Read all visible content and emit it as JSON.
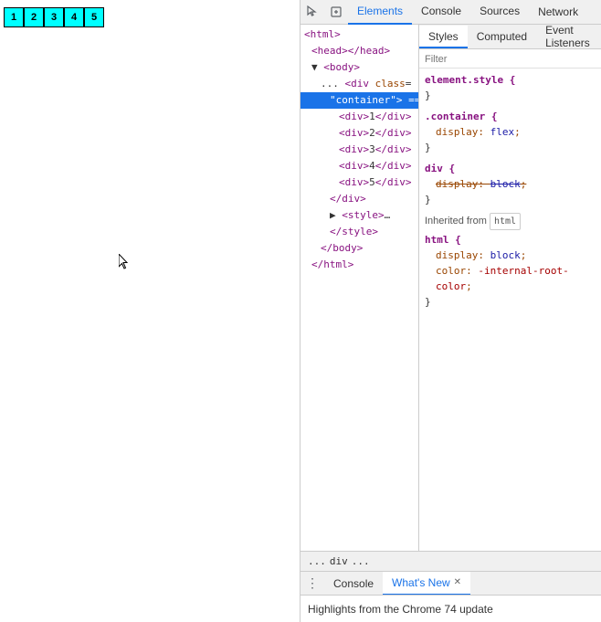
{
  "preview": {
    "boxes": [
      {
        "label": "1"
      },
      {
        "label": "2"
      },
      {
        "label": "3"
      },
      {
        "label": "4"
      },
      {
        "label": "5"
      }
    ]
  },
  "devtools": {
    "toolbar": {
      "tabs": [
        "Elements",
        "Console",
        "Sources",
        "Network"
      ]
    },
    "styles_tabs": [
      "Styles",
      "Computed",
      "Event Listeners"
    ],
    "filter_placeholder": "Filter",
    "dom": {
      "lines": [
        {
          "text": "<html>",
          "indent": 0
        },
        {
          "text": "<head></head>",
          "indent": 1
        },
        {
          "text": "▼ <body>",
          "indent": 1
        },
        {
          "text": "... <div class=",
          "indent": 2
        },
        {
          "text": "\"container\"> == $",
          "indent": 3,
          "selected": true
        },
        {
          "text": "<div>1</div>",
          "indent": 4
        },
        {
          "text": "<div>2</div>",
          "indent": 4
        },
        {
          "text": "<div>3</div>",
          "indent": 4
        },
        {
          "text": "<div>4</div>",
          "indent": 4
        },
        {
          "text": "<div>5</div>",
          "indent": 4
        },
        {
          "text": "</div>",
          "indent": 3
        },
        {
          "text": "▶ <style>…",
          "indent": 3
        },
        {
          "text": "</style>",
          "indent": 3
        },
        {
          "text": "</body>",
          "indent": 2
        },
        {
          "text": "</html>",
          "indent": 1
        }
      ]
    },
    "css_rules": [
      {
        "type": "rule",
        "selector": "element.style {",
        "properties": [],
        "close": "}"
      },
      {
        "type": "rule",
        "selector": ".container {",
        "properties": [
          {
            "name": "display",
            "value": "flex",
            "strikethrough": false
          }
        ],
        "close": "}"
      },
      {
        "type": "rule",
        "selector": "div {",
        "properties": [
          {
            "name": "display",
            "value": "block",
            "strikethrough": true
          }
        ],
        "close": "}"
      }
    ],
    "inherited_label": "Inherited from",
    "inherited_badge": "html",
    "inherited_rules": [
      {
        "selector": "html {",
        "properties": [
          {
            "name": "display",
            "value": "block",
            "strikethrough": false,
            "comment": false
          },
          {
            "name": "color",
            "value": "-internal-root-color",
            "strikethrough": false,
            "comment": true
          }
        ],
        "close": "}"
      }
    ],
    "breadcrumb": {
      "items": [
        "...",
        "div",
        "..."
      ]
    },
    "bottom_tabs": [
      "Console",
      "What's New"
    ],
    "highlights_text": "Highlights from the Chrome 74 update"
  }
}
